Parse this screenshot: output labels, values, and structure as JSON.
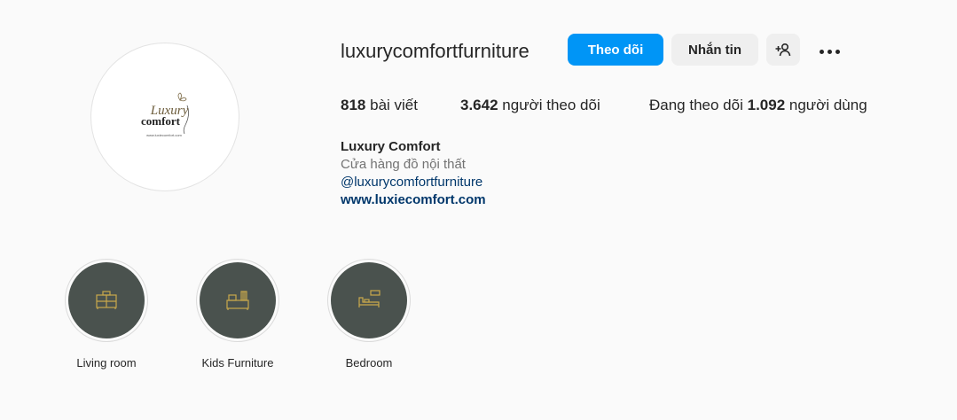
{
  "profile": {
    "username": "luxurycomfortfurniture",
    "avatar_logo": {
      "line1": "Luxury",
      "line2": "comfort",
      "caption": "www.luxiecomfort.com"
    }
  },
  "actions": {
    "follow_label": "Theo dõi",
    "message_label": "Nhắn tin",
    "suggest_icon": "add-person-icon",
    "more_icon": "more-options-icon",
    "follow_color": "#0095f6"
  },
  "stats": {
    "posts_count": "818",
    "posts_label": "bài viết",
    "followers_count": "3.642",
    "followers_label": "người theo dõi",
    "following_prefix": "Đang theo dõi",
    "following_count": "1.092",
    "following_label": "người dùng"
  },
  "bio": {
    "name": "Luxury Comfort",
    "category": "Cửa hàng đồ nội thất",
    "handle": "@luxurycomfortfurniture",
    "link": "www.luxiecomfort.com"
  },
  "highlights": [
    {
      "label": "Living room",
      "icon": "dresser-icon"
    },
    {
      "label": "Kids Furniture",
      "icon": "kids-furniture-icon"
    },
    {
      "label": "Bedroom",
      "icon": "bed-icon"
    }
  ],
  "colors": {
    "highlight_bg": "#4a524e",
    "highlight_icon": "#c9a84c"
  }
}
